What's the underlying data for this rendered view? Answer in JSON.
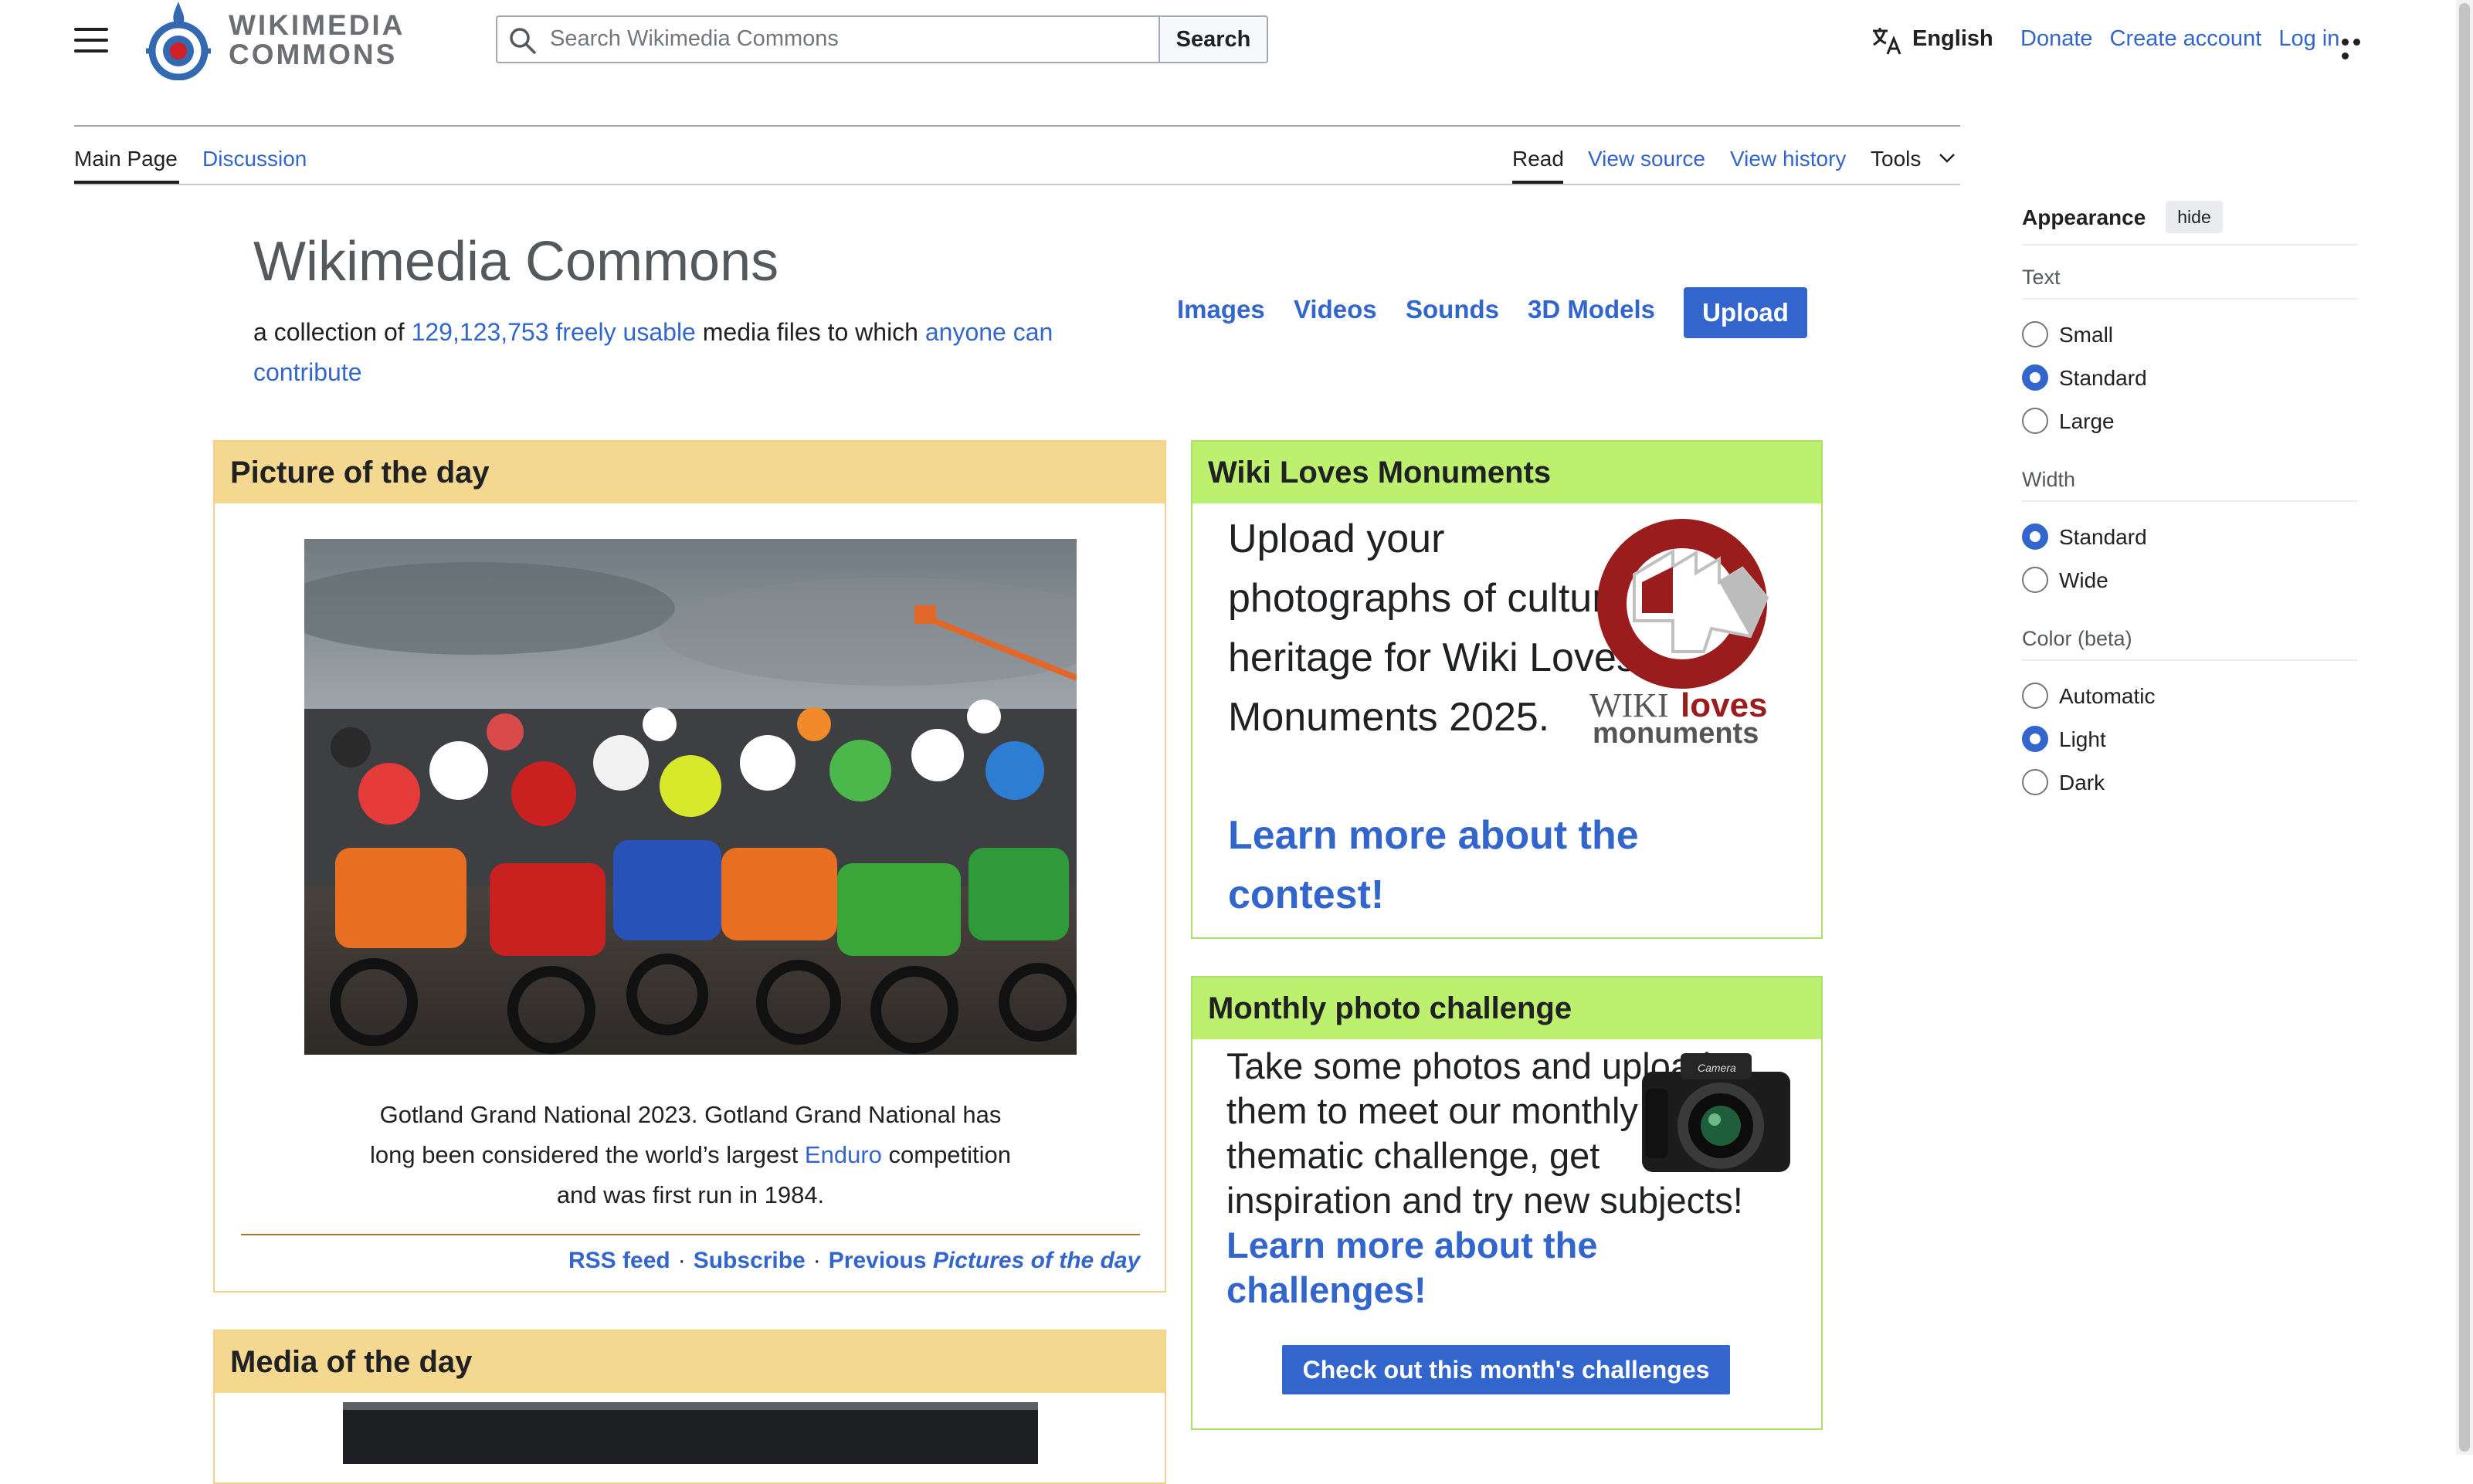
{
  "header": {
    "wordmark_line1": "WIKIMEDIA",
    "wordmark_line2": "COMMONS",
    "search_placeholder": "Search Wikimedia Commons",
    "search_button": "Search",
    "language": "English",
    "donate": "Donate",
    "create_account": "Create account",
    "log_in": "Log in"
  },
  "tabs": {
    "main_page": "Main Page",
    "discussion": "Discussion",
    "read": "Read",
    "view_source": "View source",
    "view_history": "View history",
    "tools": "Tools"
  },
  "appearance": {
    "title": "Appearance",
    "hide": "hide",
    "text_heading": "Text",
    "text_options": [
      "Small",
      "Standard",
      "Large"
    ],
    "text_selected": "Standard",
    "width_heading": "Width",
    "width_options": [
      "Standard",
      "Wide"
    ],
    "width_selected": "Standard",
    "color_heading": "Color (beta)",
    "color_options": [
      "Automatic",
      "Light",
      "Dark"
    ],
    "color_selected": "Light"
  },
  "hero": {
    "title": "Wikimedia Commons",
    "desc_prefix": "a collection of ",
    "file_count": "129,123,753",
    "freely_usable": "freely usable",
    "desc_middle": " media files to which ",
    "anyone_can_contribute": "anyone can contribute",
    "nav": [
      "Images",
      "Videos",
      "Sounds",
      "3D Models"
    ],
    "upload": "Upload"
  },
  "potd": {
    "heading": "Picture of the day",
    "caption_part1": "Gotland Grand National 2023. Gotland Grand National has long been considered the world’s largest ",
    "caption_link": "Enduro",
    "caption_part2": " competition and was first run in 1984.",
    "rss": "RSS feed",
    "subscribe": "Subscribe",
    "previous": "Previous",
    "previous_italic": "Pictures of the day",
    "separator": "·"
  },
  "motd": {
    "heading": "Media of the day"
  },
  "wlm": {
    "heading": "Wiki Loves Monuments",
    "text": "Upload your photographs of cultural heritage for Wiki Loves Monuments 2025.",
    "link": "Learn more about the contest!",
    "logo_word1": "WIKI",
    "logo_word2": "loves",
    "logo_word3": "monuments"
  },
  "mpc": {
    "heading": "Monthly photo challenge",
    "text": "Take some photos and upload them to meet our monthly thematic challenge, get inspiration and try new subjects! ",
    "link": "Learn more about the challenges!",
    "button": "Check out this month's challenges",
    "camera_label": "Camera"
  },
  "colors": {
    "link": "#3366cc",
    "potd_header": "#f5d88f",
    "green_header": "#bdf06f",
    "text": "#202122"
  }
}
